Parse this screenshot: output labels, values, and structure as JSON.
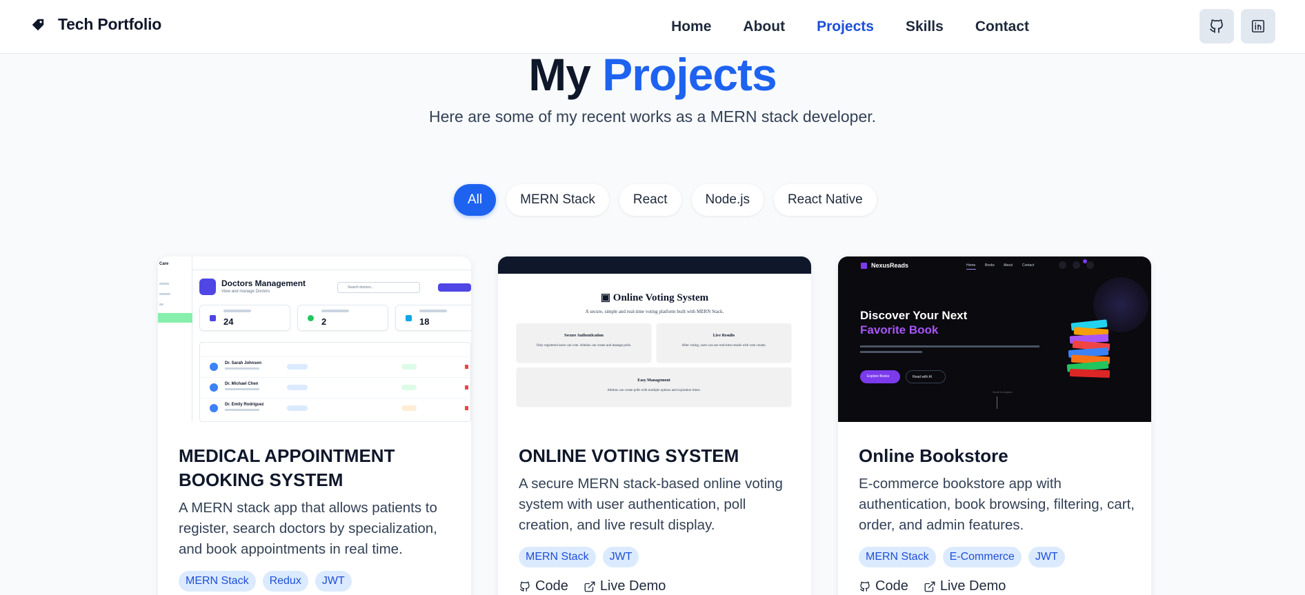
{
  "header": {
    "brand": "Tech Portfolio",
    "brand_icon": "tag-icon",
    "nav": [
      "Home",
      "About",
      "Projects",
      "Skills",
      "Contact"
    ],
    "active_nav": "Projects",
    "social_icons": [
      "github-icon",
      "linkedin-icon"
    ]
  },
  "hero": {
    "title_prefix": "My",
    "title_accent": "Projects",
    "subtitle": "Here are some of my recent works as a MERN stack developer."
  },
  "filters": {
    "items": [
      "All",
      "MERN Stack",
      "React",
      "Node.js",
      "React Native"
    ],
    "active": "All"
  },
  "projects": [
    {
      "title": "MEDICAL APPOINTMENT BOOKING SYSTEM",
      "description": "A MERN stack app that allows patients to register, search doctors by specialization, and book appointments in real time.",
      "tags": [
        "MERN Stack",
        "Redux",
        "JWT"
      ],
      "thumbnail": {
        "sidebar_brand": "Care",
        "heading": "Doctors Management",
        "subheading": "View and manage Doctors",
        "search_placeholder": "Search doctors...",
        "stats": [
          "24",
          "2",
          "18"
        ],
        "rows": [
          "Dr. Sarah Johnson",
          "Dr. Michael Chen",
          "Dr. Emily Rodriguez"
        ]
      }
    },
    {
      "title": "ONLINE VOTING SYSTEM",
      "description": "A secure MERN stack-based online voting system with user authentication, poll creation, and live result display.",
      "tags": [
        "MERN Stack",
        "JWT"
      ],
      "links": [
        "Code",
        "Live Demo"
      ],
      "thumbnail": {
        "heading": "Online Voting System",
        "subheading": "A secure, simple and real-time voting platform built with MERN Stack.",
        "features": [
          {
            "title": "Secure Authentication",
            "text": "Only registered users can vote. Admins can create and manage polls."
          },
          {
            "title": "Live Results",
            "text": "After voting, users can see real-time results with vote counts."
          },
          {
            "title": "Easy Management",
            "text": "Admins can create polls with multiple options and expiration times."
          }
        ]
      }
    },
    {
      "title": "Online Bookstore",
      "description": "E-commerce bookstore app with authentication, book browsing, filtering, cart, order, and admin features.",
      "tags": [
        "MERN Stack",
        "E-Commerce",
        "JWT"
      ],
      "links": [
        "Code",
        "Live Demo"
      ],
      "thumbnail": {
        "brand": "NexusReads",
        "nav": [
          "Home",
          "Books",
          "About",
          "Contact"
        ],
        "headline_1": "Discover Your Next",
        "headline_2": "Favorite Book",
        "btn_primary": "Explore Books",
        "btn_secondary": "Read with AI",
        "scroll_hint": "Scroll to explore"
      }
    }
  ],
  "colors": {
    "accent": "#1d63f0",
    "nav_active": "#1d4ed8",
    "tag_bg": "#dbeafe",
    "tag_text": "#1d4ed8",
    "page_bg": "#f8fafc"
  }
}
